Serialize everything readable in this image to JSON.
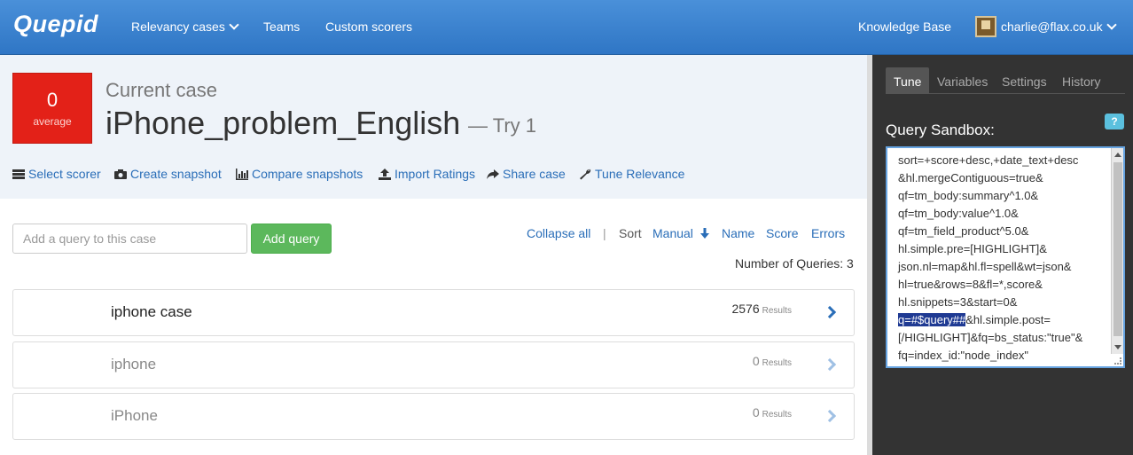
{
  "navbar": {
    "brand": "Quepid",
    "links": [
      "Relevancy cases",
      "Teams",
      "Custom scorers"
    ],
    "knowledge_base": "Knowledge Base",
    "user": "charlie@flax.co.uk"
  },
  "case": {
    "score": "0",
    "score_label": "average",
    "current_label": "Current case",
    "name": "iPhone_problem_English",
    "try": "— Try 1"
  },
  "actions": [
    "Select scorer",
    "Create snapshot",
    "Compare snapshots",
    "Import Ratings",
    "Share case",
    "Tune Relevance"
  ],
  "query_bar": {
    "placeholder": "Add a query to this case",
    "add_label": "Add query",
    "collapse_all": "Collapse all",
    "separator": "|",
    "sort_label": "Sort",
    "sort_options": [
      "Manual",
      "Name",
      "Score",
      "Errors"
    ],
    "num_queries": "Number of Queries: 3"
  },
  "queries": [
    {
      "text": "iphone case",
      "count": "2576",
      "results_label": "Results"
    },
    {
      "text": "iphone",
      "count": "0",
      "results_label": "Results"
    },
    {
      "text": "iPhone",
      "count": "0",
      "results_label": "Results"
    }
  ],
  "side": {
    "tabs": [
      "Tune",
      "Variables",
      "Settings",
      "History"
    ],
    "sandbox_label": "Query Sandbox:",
    "help": "?",
    "sandbox_pre": "sort=+score+desc,+date_text+desc\n&hl.mergeContiguous=true&\nqf=tm_body:summary^1.0&\nqf=tm_body:value^1.0&\nqf=tm_field_product^5.0&\nhl.simple.pre=[HIGHLIGHT]&\njson.nl=map&hl.fl=spell&wt=json&\nhl=true&rows=8&fl=*,score&\nhl.snippets=3&start=0&\n",
    "sandbox_highlight": "q=#$query##",
    "sandbox_post": "&hl.simple.post=\n[/HIGHLIGHT]&fq=bs_status:\"true\"&\nfq=index_id:\"node_index\""
  },
  "icons": {
    "chevron": "chevron-down-icon",
    "row_arrow": "chevron-right-icon"
  }
}
